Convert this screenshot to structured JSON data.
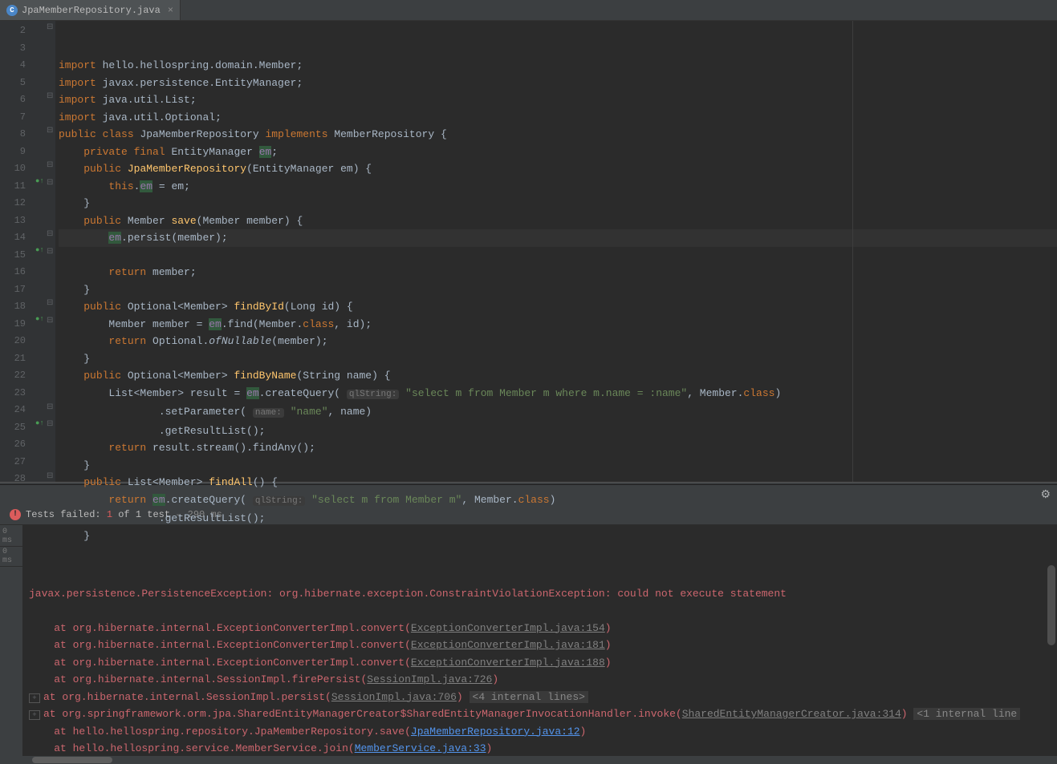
{
  "tab": {
    "filename": "JpaMemberRepository.java"
  },
  "lines": [
    "2",
    "3",
    "4",
    "5",
    "6",
    "7",
    "8",
    "9",
    "10",
    "11",
    "12",
    "13",
    "14",
    "15",
    "16",
    "17",
    "18",
    "19",
    "20",
    "21",
    "22",
    "23",
    "24",
    "25",
    "26",
    "27",
    "28"
  ],
  "code": {
    "l3": "javax.persistence.EntityManager",
    "l4": "java.util.List",
    "l5": "java.util.Optional",
    "cl": "JpaMemberRepository",
    "impl": "MemberRepository",
    "em_type": "EntityManager",
    "em": "em",
    "ctor_param": "(EntityManager em) {",
    "this": "this",
    "save": "save",
    "save_param": "(Member member) {",
    "persist": ".persist(member)",
    "ret_member": "member",
    "findById": "findById",
    "findById_param": "(Long id) {",
    "mem_decl": "Member member = ",
    "find_args": ".find(Member.",
    "class": "class",
    "id_arg": ", id)",
    "optional": "Optional.",
    "ofNullable": "ofNullable",
    "ofN_arg": "(member)",
    "findByName": "findByName",
    "findByName_param": "(String name) {",
    "list_decl": "List<Member> result = ",
    "createQuery": ".createQuery(",
    "qlhint": "qlString:",
    "q1": "\"select m from Member m where m.name = :name\"",
    "mem_class": ", Member.",
    "setParam": ".setParameter(",
    "namehint": "name:",
    "name_args": "\"name\"",
    "name_var": ", name)",
    "getRL": ".getResultList()",
    "stream": "result.stream().findAny()",
    "findAll": "findAll",
    "findAll_param": "() {",
    "q2": "\"select m from Member m\""
  },
  "test": {
    "label": "Tests failed:",
    "count": "1",
    "of": "of 1 test",
    "time": "– 290 ms",
    "ms": "0 ms"
  },
  "stack": {
    "ex": "javax.persistence.PersistenceException: org.hibernate.exception.ConstraintViolationException: could not execute statement",
    "l1p": "at org.hibernate.internal.ExceptionConverterImpl.convert(",
    "l1l": "ExceptionConverterImpl.java:154",
    "l2l": "ExceptionConverterImpl.java:181",
    "l3l": "ExceptionConverterImpl.java:188",
    "l4p": "at org.hibernate.internal.SessionImpl.firePersist(",
    "l4l": "SessionImpl.java:726",
    "l5p": "at org.hibernate.internal.SessionImpl.persist(",
    "l5l": "SessionImpl.java:706",
    "fold1": "<4 internal lines>",
    "l6p": "at org.springframework.orm.jpa.SharedEntityManagerCreator$SharedEntityManagerInvocationHandler.invoke(",
    "l6l": "SharedEntityManagerCreator.java:314",
    "fold2": "<1 internal line",
    "l7p": "at hello.hellospring.repository.JpaMemberRepository.save(",
    "l7l": "JpaMemberRepository.java:12",
    "l8p": "at hello.hellospring.service.MemberService.join(",
    "l8l": "MemberService.java:33"
  }
}
